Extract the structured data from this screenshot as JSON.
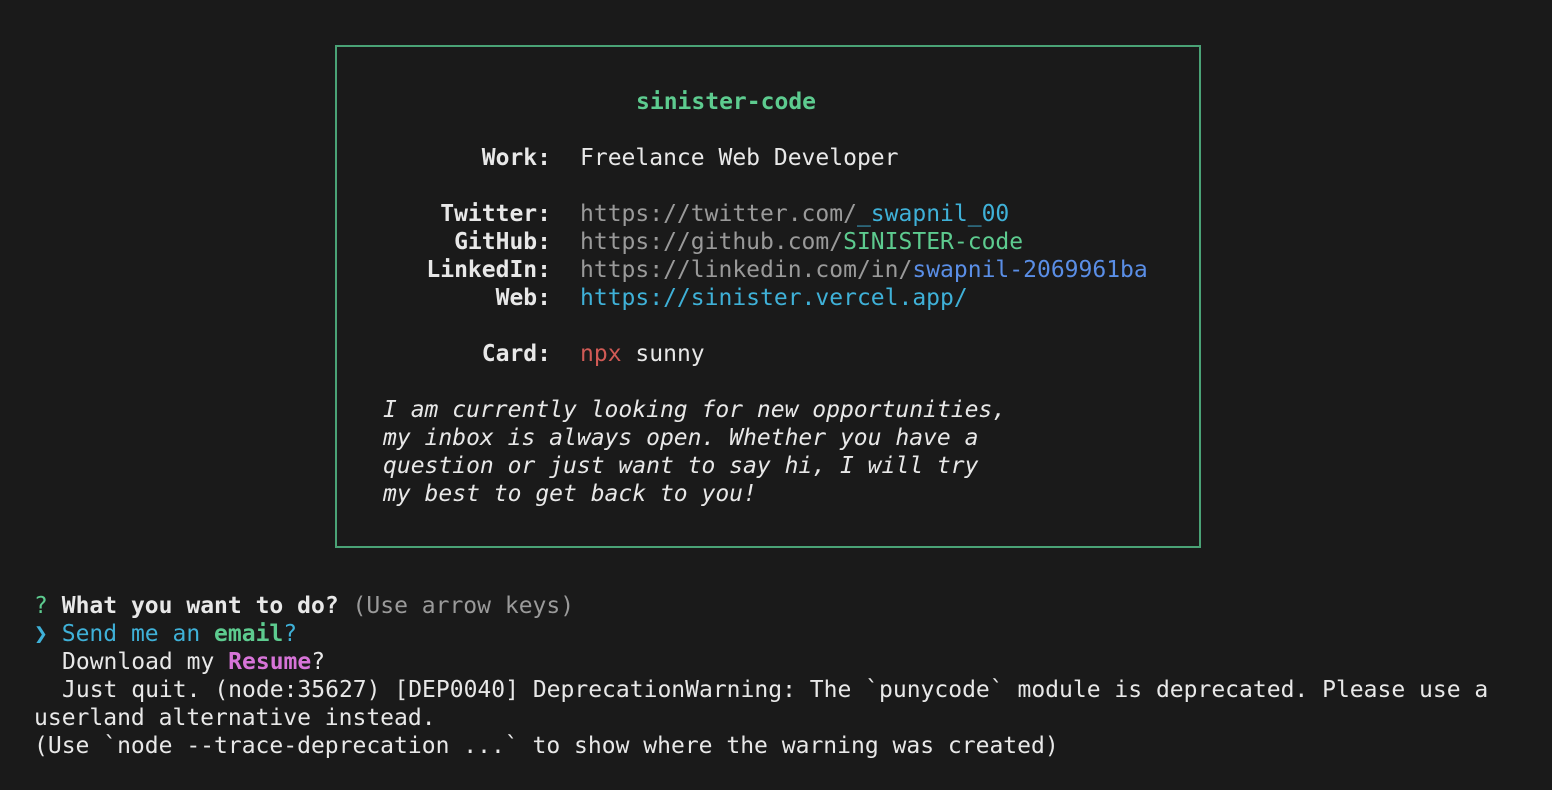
{
  "card": {
    "name": "sinister-code",
    "work_label": "Work:",
    "work_value": "Freelance Web Developer",
    "twitter_label": "Twitter:",
    "twitter_prefix": "https://twitter.com/",
    "twitter_handle": "_swapnil_00",
    "github_label": "GitHub:",
    "github_prefix": "https://github.com/",
    "github_handle": "SINISTER-code",
    "linkedin_label": "LinkedIn:",
    "linkedin_prefix": "https://linkedin.com/in/",
    "linkedin_handle": "swapnil-2069961ba",
    "web_label": "Web:",
    "web_url": "https://sinister.vercel.app/",
    "card_label": "Card:",
    "card_cmd": "npx",
    "card_arg": "sunny",
    "message_lines": [
      "I am currently looking for new opportunities,",
      "my inbox is always open. Whether you have a",
      "question or just want to say hi, I will try",
      "my best to get back to you!"
    ]
  },
  "prompt": {
    "question_mark": "?",
    "question": "What you want to do?",
    "hint": "(Use arrow keys)",
    "pointer": "❯",
    "options": [
      {
        "before": "Send me an ",
        "highlight": "email",
        "after": "?"
      },
      {
        "before": "Download my ",
        "highlight": "Resume",
        "after": "?"
      },
      {
        "before": "Just quit.",
        "highlight": "",
        "after": ""
      }
    ]
  },
  "warning": {
    "line1": " (node:35627) [DEP0040] DeprecationWarning: The `punycode` module is deprecated. Please use a",
    "line2": "userland alternative instead.",
    "line3": "(Use `node --trace-deprecation ...` to show where the warning was created)"
  },
  "colors": {
    "background": "#1a1a1a",
    "border": "#4aa276",
    "green": "#5dcb8f",
    "cyan": "#3fb1d8",
    "blue": "#5a8ee6",
    "red": "#d05a55",
    "magenta": "#d774d8"
  }
}
